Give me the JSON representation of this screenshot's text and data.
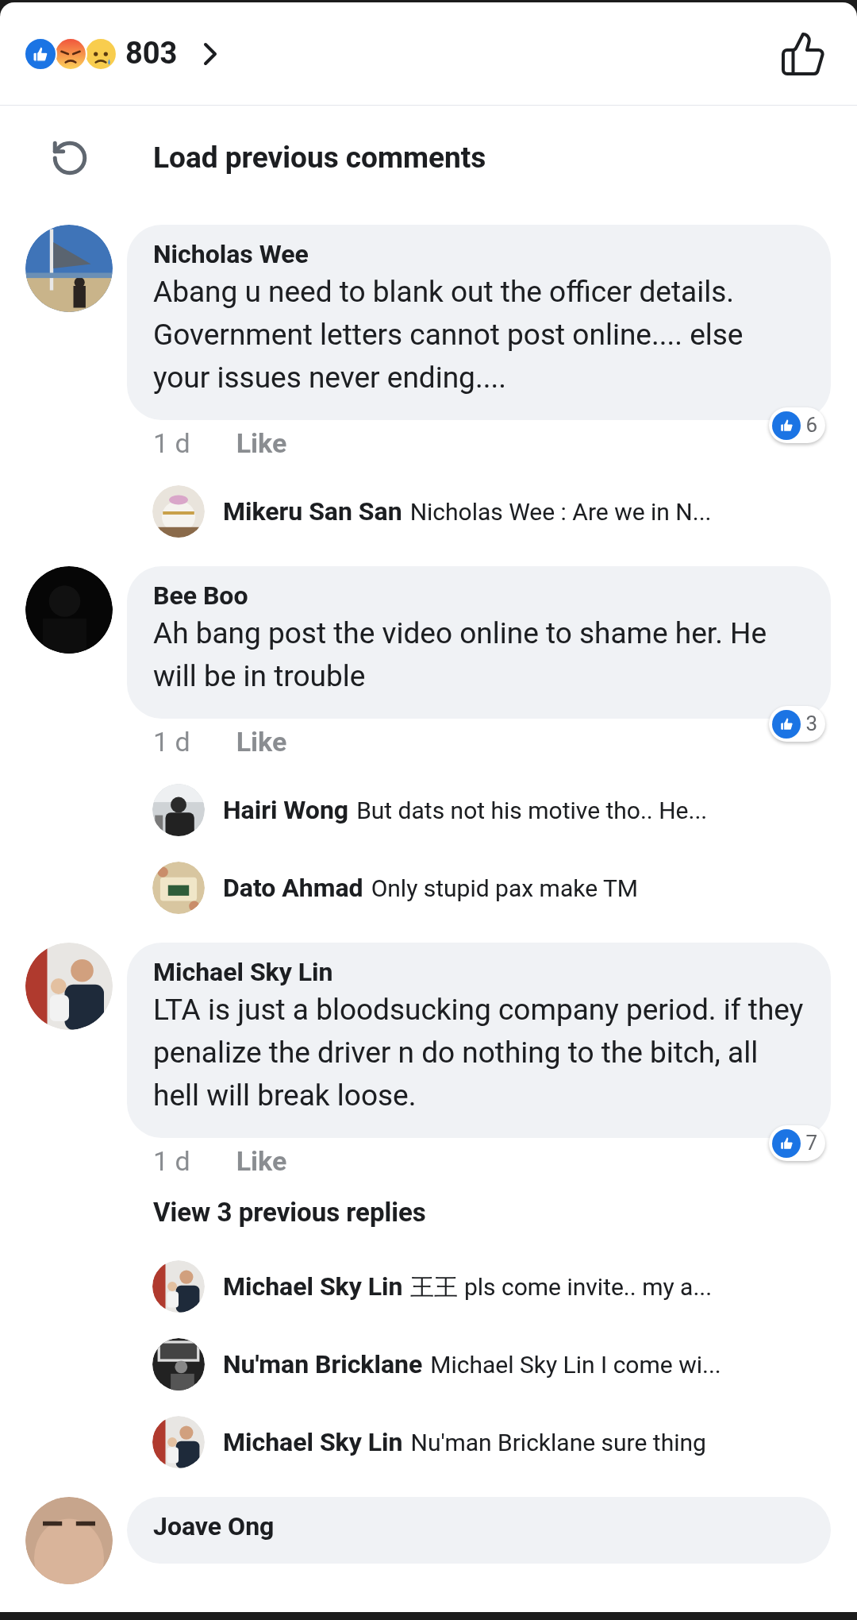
{
  "header": {
    "reactions": [
      {
        "kind": "like"
      },
      {
        "kind": "angry"
      },
      {
        "kind": "sad"
      }
    ],
    "count": "803"
  },
  "load_previous": "Load previous comments",
  "comments": [
    {
      "author": "Nicholas Wee",
      "text": "Abang u need to blank out the officer details. Government letters cannot post online.... else your issues never ending....",
      "time": "1 d",
      "like_label": "Like",
      "like_count": "6",
      "replies": [
        {
          "author": "Mikeru San San",
          "text": "Nicholas Wee : Are we in N..."
        }
      ]
    },
    {
      "author": "Bee Boo",
      "text": "Ah bang post the video online to shame her. He will be in trouble",
      "time": "1 d",
      "like_label": "Like",
      "like_count": "3",
      "replies": [
        {
          "author": "Hairi Wong",
          "text": "But dats not his motive tho.. He..."
        },
        {
          "author": "Dato Ahmad",
          "text": "Only stupid pax make TM"
        }
      ]
    },
    {
      "author": "Michael Sky Lin",
      "text": "LTA is just a bloodsucking company period. if they penalize the driver n do nothing to the bitch, all hell will break loose.",
      "time": "1 d",
      "like_label": "Like",
      "like_count": "7",
      "view_replies": "View 3 previous replies",
      "replies": [
        {
          "author": "Michael Sky Lin",
          "text": "王王 pls come invite.. my a..."
        },
        {
          "author": "Nu'man Bricklane",
          "text": "Michael Sky Lin I come wi..."
        },
        {
          "author": "Michael Sky Lin",
          "text": "Nu'man Bricklane sure thing"
        }
      ]
    },
    {
      "author": "Joave Ong"
    }
  ]
}
